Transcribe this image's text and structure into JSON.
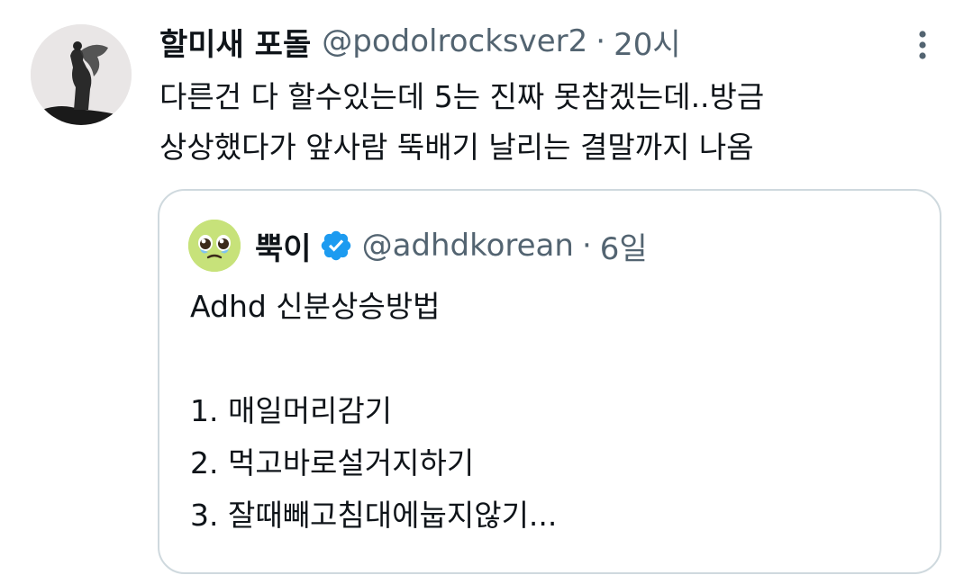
{
  "tweet": {
    "author_name": "할미새 포돌",
    "author_handle": "@podolrocksver2",
    "separator": "·",
    "time": "20시",
    "more_icon": "more-vertical-icon",
    "text_lines": [
      "다른건 다 할수있는데 5는 진짜 못참겠는데..방금",
      "상상했다가 앞사람 뚝배기 날리는 결말까지 나옴"
    ]
  },
  "quote": {
    "author_name": "뿍이",
    "verified_icon": "verified-badge-icon",
    "author_handle": "@adhdkorean",
    "separator": "·",
    "time": "6일",
    "title": "Adhd 신분상승방법",
    "items": [
      "1. 매일머리감기",
      "2. 먹고바로설거지하기",
      "3. 잘때빼고침대에눕지않기..."
    ]
  },
  "colors": {
    "text_primary": "#0f1419",
    "text_secondary": "#536471",
    "border": "#cfd9de",
    "verified": "#1d9bf0",
    "quote_avatar_bg": "#c7e27a"
  }
}
